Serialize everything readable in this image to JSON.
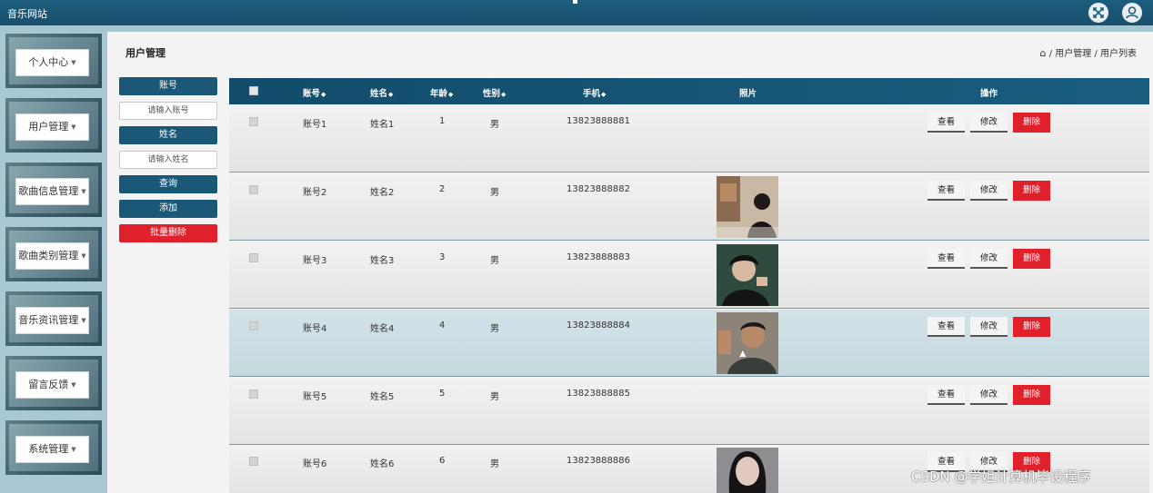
{
  "app": {
    "title": "音乐网站"
  },
  "topbar": {
    "fullscreen_icon": "fullscreen-icon",
    "user_icon": "user-avatar-icon"
  },
  "sidebar": {
    "items": [
      {
        "label": "个人中心"
      },
      {
        "label": "用户管理"
      },
      {
        "label": "歌曲信息管理"
      },
      {
        "label": "歌曲类别管理"
      },
      {
        "label": "音乐资讯管理"
      },
      {
        "label": "留言反馈"
      },
      {
        "label": "系统管理"
      }
    ]
  },
  "page": {
    "title": "用户管理",
    "breadcrumb": {
      "sep": "/",
      "level1": "用户管理",
      "level2": "用户列表"
    }
  },
  "search": {
    "account_label": "账号",
    "account_placeholder": "请输入账号",
    "name_label": "姓名",
    "name_placeholder": "请输入姓名",
    "query_button": "查询",
    "add_button": "添加",
    "batch_delete_button": "批量删除"
  },
  "table": {
    "headers": {
      "account": "账号",
      "name": "姓名",
      "age": "年龄",
      "gender": "性别",
      "phone": "手机",
      "photo": "照片",
      "actions": "操作"
    },
    "action_labels": {
      "view": "查看",
      "edit": "修改",
      "delete": "删除"
    },
    "rows": [
      {
        "account": "账号1",
        "name": "姓名1",
        "age": "1",
        "gender": "男",
        "phone": "13823888881"
      },
      {
        "account": "账号2",
        "name": "姓名2",
        "age": "2",
        "gender": "男",
        "phone": "13823888882"
      },
      {
        "account": "账号3",
        "name": "姓名3",
        "age": "3",
        "gender": "男",
        "phone": "13823888883"
      },
      {
        "account": "账号4",
        "name": "姓名4",
        "age": "4",
        "gender": "男",
        "phone": "13823888884"
      },
      {
        "account": "账号5",
        "name": "姓名5",
        "age": "5",
        "gender": "男",
        "phone": "13823888885"
      },
      {
        "account": "账号6",
        "name": "姓名6",
        "age": "6",
        "gender": "男",
        "phone": "13823888886"
      }
    ]
  },
  "watermark": "CSDN @学姐计算机毕设程序",
  "colors": {
    "primary": "#1b5877",
    "danger": "#e0202a",
    "sidebar_bg": "#a9c8d3",
    "highlight_row": "#d3e3e8"
  }
}
